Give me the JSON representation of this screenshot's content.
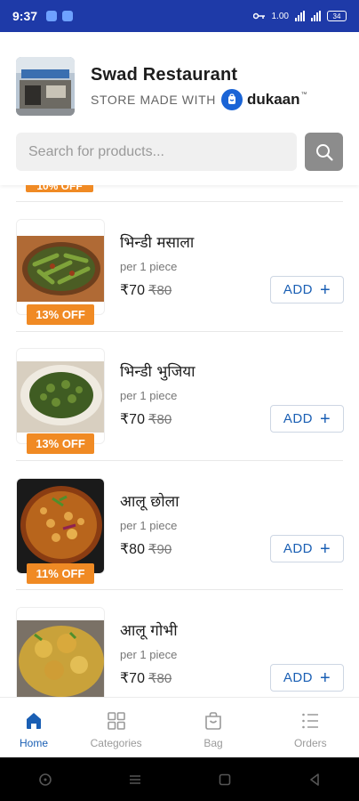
{
  "status_bar": {
    "time": "9:37",
    "data_rate": "1.00",
    "battery": "34"
  },
  "store": {
    "name": "Swad Restaurant",
    "made_with": "STORE MADE WITH",
    "brand": "dukaan",
    "trademark": "™"
  },
  "search": {
    "placeholder": "Search for products..."
  },
  "partial_badge": "10% OFF",
  "products": [
    {
      "name": "भिन्डी मसाला",
      "unit": "per 1 piece",
      "price": "₹70",
      "mrp": "₹80",
      "discount": "13% OFF",
      "add_label": "ADD",
      "image": "bhindi-masala-photo"
    },
    {
      "name": "भिन्डी भुजिया",
      "unit": "per 1 piece",
      "price": "₹70",
      "mrp": "₹80",
      "discount": "13% OFF",
      "add_label": "ADD",
      "image": "bhindi-bhujiya-photo"
    },
    {
      "name": "आलू छोला",
      "unit": "per 1 piece",
      "price": "₹80",
      "mrp": "₹90",
      "discount": "11% OFF",
      "add_label": "ADD",
      "image": "aloo-chhola-photo"
    },
    {
      "name": "आलू गोभी",
      "unit": "per 1 piece",
      "price": "₹70",
      "mrp": "₹80",
      "discount": "",
      "add_label": "ADD",
      "image": "aloo-gobhi-photo"
    }
  ],
  "nav": [
    {
      "label": "Home",
      "icon": "home-icon",
      "active": true
    },
    {
      "label": "Categories",
      "icon": "grid-icon",
      "active": false
    },
    {
      "label": "Bag",
      "icon": "bag-icon",
      "active": false
    },
    {
      "label": "Orders",
      "icon": "orders-list-icon",
      "active": false
    }
  ],
  "colors": {
    "status_bar": "#1e3aa8",
    "accent": "#1a5fb4",
    "discount_badge": "#f08a24",
    "search_button": "#8c8c8c"
  }
}
